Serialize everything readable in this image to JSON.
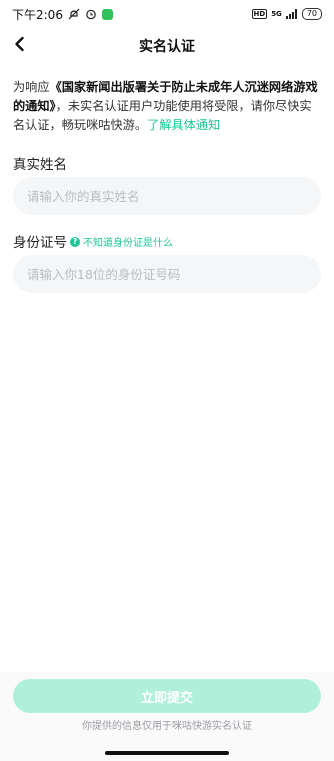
{
  "status_bar": {
    "time": "下午2:06",
    "network": "5G",
    "battery": "70",
    "hd": "HD"
  },
  "nav": {
    "title": "实名认证"
  },
  "notice": {
    "prefix": "为响应",
    "doc_title": "《国家新闻出版署关于防止未成年人沉迷网络游戏的通知》",
    "body": "，未实名认证用户功能使用将受限，请你尽快实名认证，畅玩咪咕快游。",
    "link": "了解具体通知"
  },
  "form": {
    "name_label": "真实姓名",
    "name_placeholder": "请输入你的真实姓名",
    "id_label": "身份证号",
    "id_help": "不知道身份证是什么",
    "id_placeholder": "请输入你18位的身份证号码"
  },
  "footer": {
    "submit_label": "立即提交",
    "privacy_note": "你提供的信息仅用于咪咕快游实名认证"
  },
  "colors": {
    "accent": "#1fc597",
    "button_disabled": "#b0f0db",
    "input_bg": "#f5f6f7"
  }
}
